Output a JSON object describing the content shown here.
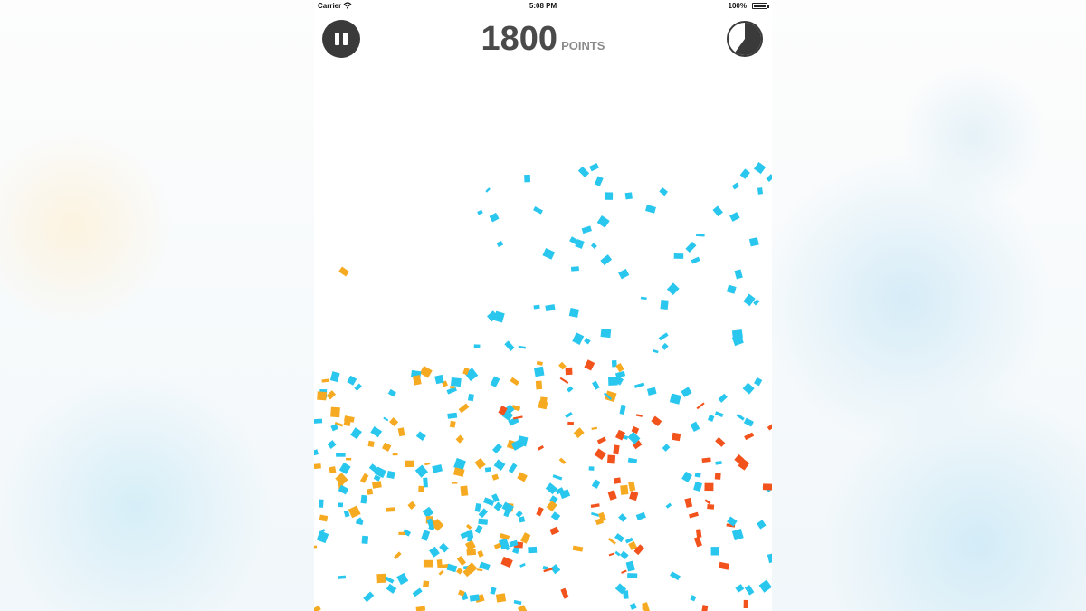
{
  "status_bar": {
    "carrier": "Carrier",
    "time": "5:08 PM",
    "battery": "100%"
  },
  "hud": {
    "score_value": "1800",
    "score_unit": "POINTS",
    "timer_elapsed_fraction": 0.6
  },
  "colors": {
    "blue": "#29c6ee",
    "yellow": "#f5aa22",
    "orange": "#f2521c",
    "button_dark": "#3a3a3a"
  },
  "icons": {
    "pause": "pause-icon",
    "timer": "timer-pie-icon",
    "wifi": "wifi-icon",
    "battery": "battery-icon"
  }
}
